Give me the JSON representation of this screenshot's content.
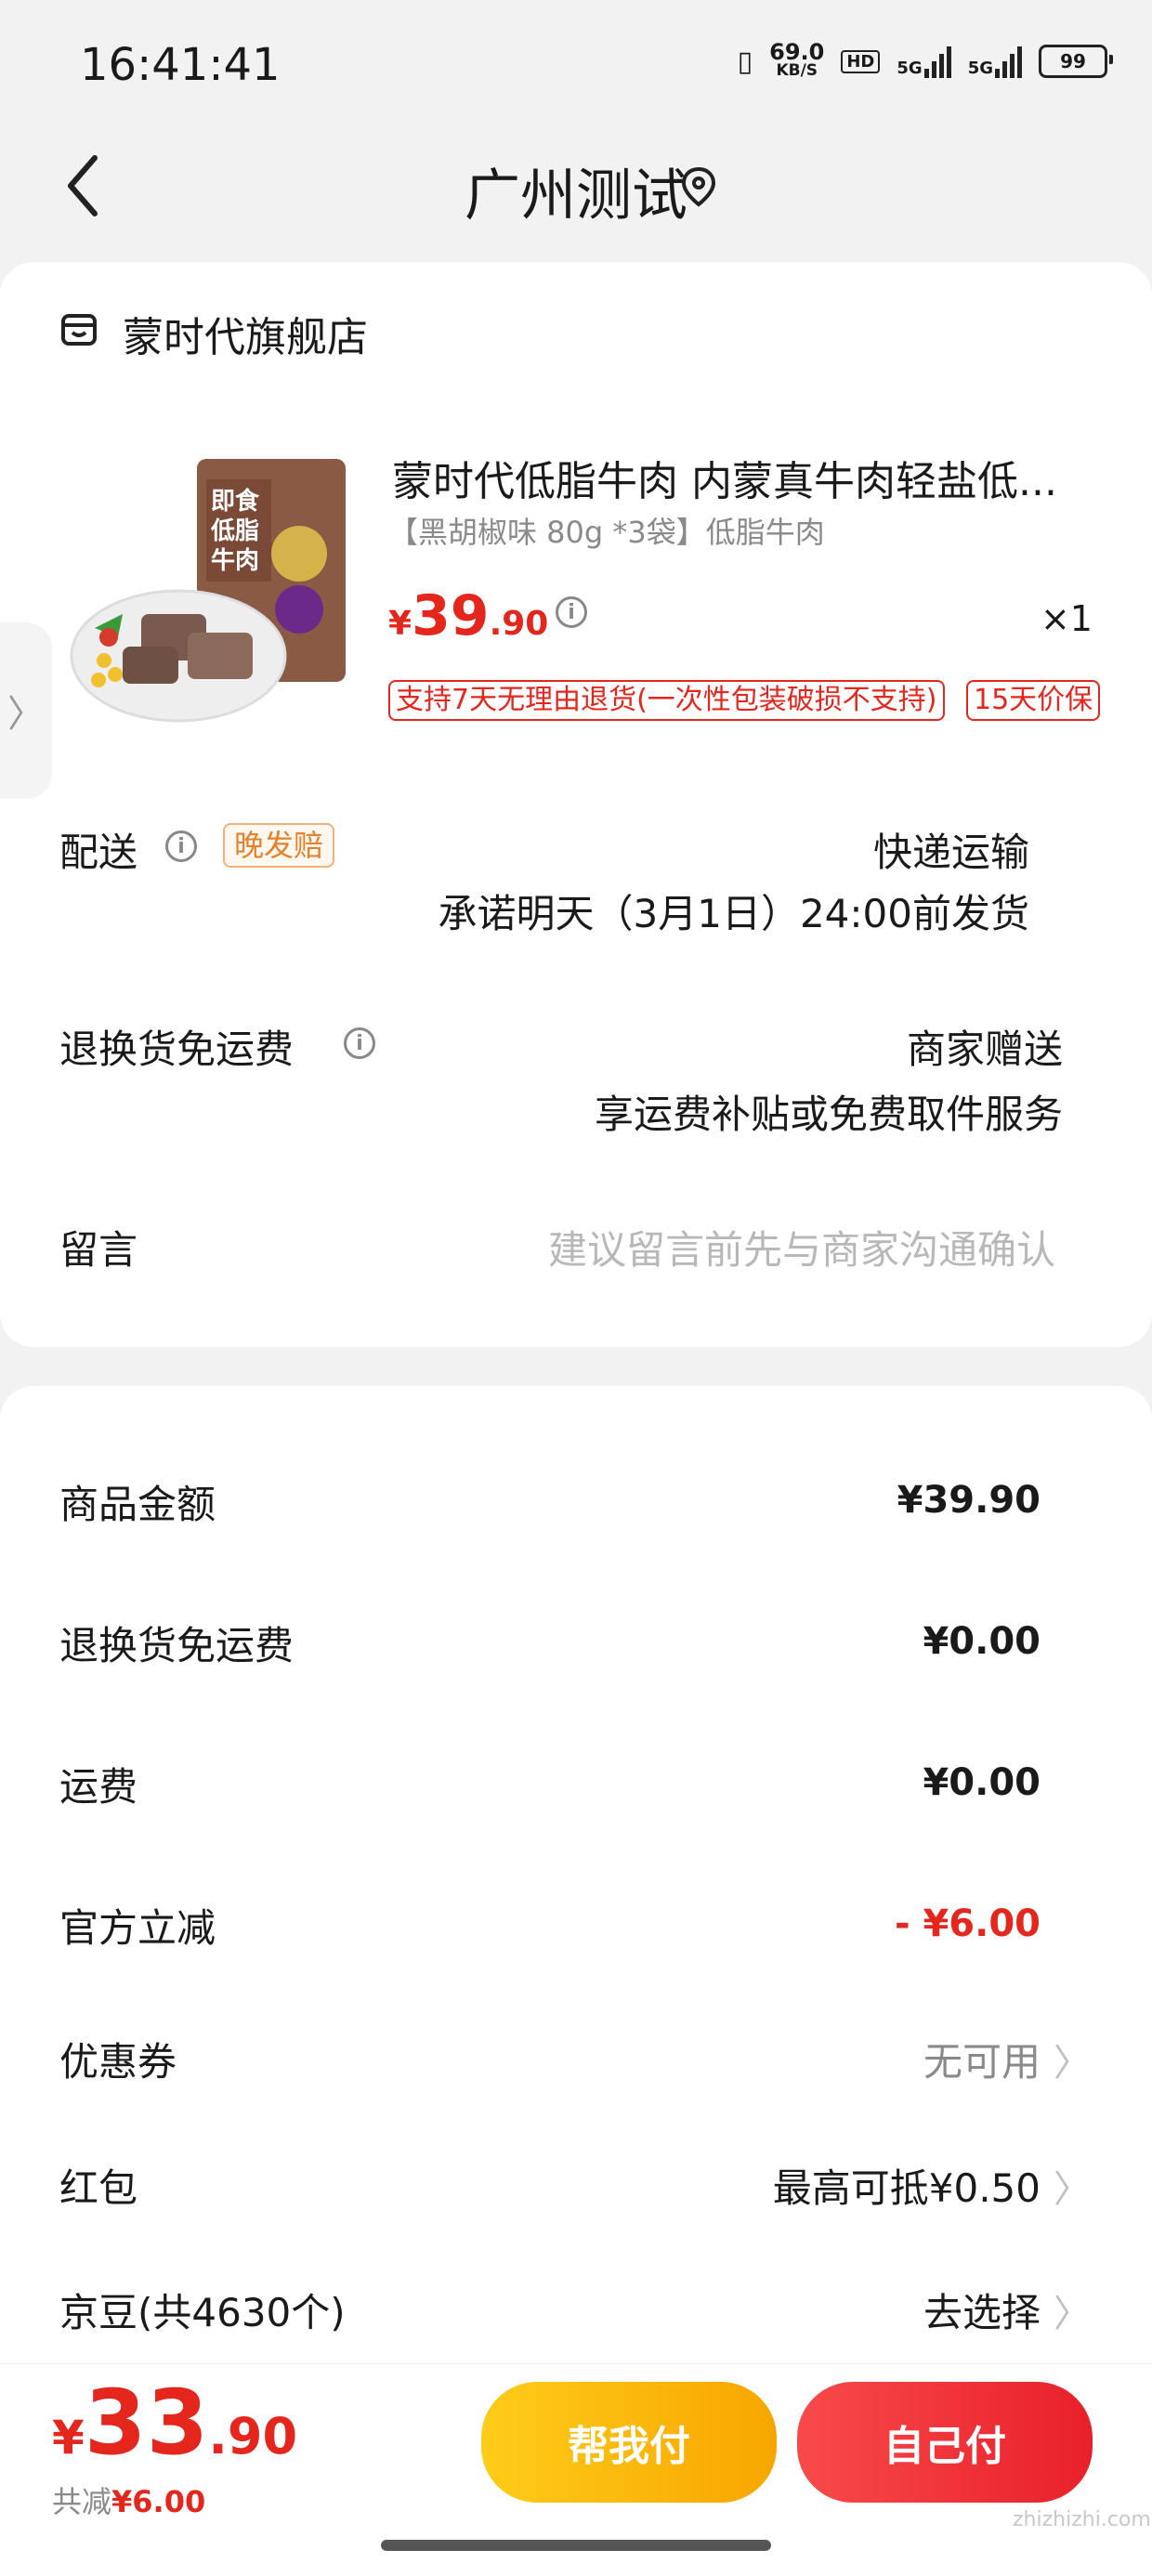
{
  "status_bar": {
    "time": "16:41:41",
    "net_speed_value": "69.0",
    "net_speed_unit": "KB/S",
    "hd_label": "HD",
    "net1": "5G",
    "net2": "5G",
    "battery": "99"
  },
  "nav": {
    "title": "广州测试",
    "back_icon": "chevron-left-icon",
    "location_icon": "location-pin-icon"
  },
  "store": {
    "name": "蒙时代旗舰店",
    "icon": "store-icon"
  },
  "product": {
    "title": "蒙时代低脂牛肉 内蒙真牛肉轻盐低...",
    "spec": "【黑胡椒味 80g *3袋】低脂牛肉",
    "price_currency": "¥",
    "price_int": "39",
    "price_dec": ".90",
    "quantity": "×1",
    "tags": [
      "支持7天无理由退货(一次性包装破损不支持)",
      "15天价保"
    ],
    "image_text": "即食低脂牛肉"
  },
  "delivery": {
    "label": "配送",
    "badge": "晚发赔",
    "method": "快递运输",
    "promise": "承诺明天（3月1日）24:00前发货"
  },
  "return_shipping": {
    "label": "退换货免运费",
    "line1": "商家赠送",
    "line2": "享运费补贴或免费取件服务"
  },
  "message": {
    "label": "留言",
    "placeholder": "建议留言前先与商家沟通确认"
  },
  "summary": {
    "items": [
      {
        "label": "商品金额",
        "value": "¥39.90"
      },
      {
        "label": "退换货免运费",
        "value": "¥0.00"
      },
      {
        "label": "运费",
        "value": "¥0.00"
      },
      {
        "label": "官方立减",
        "value": "- ¥6.00"
      }
    ],
    "coupon": {
      "label": "优惠券",
      "value": "无可用"
    },
    "redpacket": {
      "label": "红包",
      "value": "最高可抵¥0.50"
    },
    "jingdou": {
      "label": "京豆(共4630个)",
      "value": "去选择"
    }
  },
  "footer": {
    "total_currency": "¥",
    "total_int": "33",
    "total_dec": ".90",
    "saved_label": "共减",
    "saved_value": "¥6.00",
    "help_pay": "帮我付",
    "self_pay": "自己付"
  },
  "watermark": "zhizhizhi.com",
  "colors": {
    "accent_red": "#e4261d",
    "yellow_button": "#f7a600",
    "red_button": "#e8202a"
  }
}
